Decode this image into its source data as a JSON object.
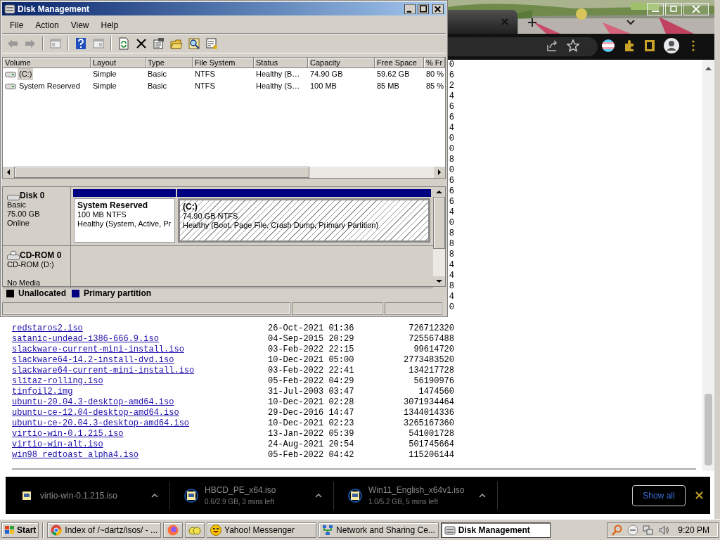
{
  "browser": {
    "listing": {
      "fragments": [
        "0",
        "6",
        "2",
        "4",
        "6",
        "6",
        "4",
        "0",
        "0",
        "8",
        "0",
        "6",
        "6",
        "6",
        "4",
        "0",
        "8",
        "8",
        "8",
        "4",
        "4",
        "8",
        "4",
        "0"
      ],
      "rows": [
        {
          "name": "redstaros2.iso",
          "date": "26-Oct-2021 01:36",
          "size": "726712320"
        },
        {
          "name": "satanic-undead-i386-666.9.iso",
          "date": "04-Sep-2015 20:29",
          "size": "725567488"
        },
        {
          "name": "slackware-current-mini-install.iso",
          "date": "03-Feb-2022 22:15",
          "size": "99614720"
        },
        {
          "name": "slackware64-14.2-install-dvd.iso",
          "date": "10-Dec-2021 05:00",
          "size": "2773483520"
        },
        {
          "name": "slackware64-current-mini-install.iso",
          "date": "03-Feb-2022 22:41",
          "size": "134217728"
        },
        {
          "name": "slitaz-rolling.iso",
          "date": "05-Feb-2022 04:29",
          "size": "56190976"
        },
        {
          "name": "tinfoil2.img",
          "date": "31-Jul-2003 03:47",
          "size": "1474560"
        },
        {
          "name": "ubuntu-20.04.3-desktop-amd64.iso",
          "date": "10-Dec-2021 02:28",
          "size": "3071934464"
        },
        {
          "name": "ubuntu-ce-12.04-desktop-amd64.iso",
          "date": "29-Dec-2016 14:47",
          "size": "1344014336"
        },
        {
          "name": "ubuntu-ce-20.04.3-desktop-amd64.iso",
          "date": "10-Dec-2021 02:23",
          "size": "3265167360"
        },
        {
          "name": "virtio-win-0.1.215.iso",
          "date": "13-Jan-2022 05:39",
          "size": "541001728"
        },
        {
          "name": "virtio-win-alt.iso",
          "date": "24-Aug-2021 20:54",
          "size": "501745664"
        },
        {
          "name": "win98_redtoast_alpha4.iso",
          "date": "05-Feb-2022 04:42",
          "size": "115206144"
        }
      ]
    },
    "downloads": [
      {
        "name": "virtio-win-0.1.215.iso"
      },
      {
        "name": "HBCD_PE_x64.iso",
        "detail": "0.6/2.9 GB, 3 mins left"
      },
      {
        "name": "Win11_English_x64v1.iso",
        "detail": "1.0/5.2 GB, 5 mins left"
      }
    ],
    "show_all": "Show all"
  },
  "disk_management": {
    "title": "Disk Management",
    "menu": [
      "File",
      "Action",
      "View",
      "Help"
    ],
    "columns": [
      "Volume",
      "Layout",
      "Type",
      "File System",
      "Status",
      "Capacity",
      "Free Space",
      "% Fr"
    ],
    "volumes": [
      {
        "cells": [
          "(C:)",
          "Simple",
          "Basic",
          "NTFS",
          "Healthy (B…",
          "74.90 GB",
          "59.62 GB",
          "80 %"
        ],
        "selected": true
      },
      {
        "cells": [
          "System Reserved",
          "Simple",
          "Basic",
          "NTFS",
          "Healthy (S…",
          "100 MB",
          "85 MB",
          "85 %"
        ],
        "selected": false
      }
    ],
    "disks": [
      {
        "kind": "disk",
        "name": "Disk 0",
        "lines": [
          "Basic",
          "75.00 GB",
          "Online"
        ],
        "partitions": [
          {
            "name": "System Reserved",
            "size": "100 MB NTFS",
            "status": "Healthy (System, Active, Pr",
            "selected": false
          },
          {
            "name": "(C:)",
            "size": "74.90 GB NTFS",
            "status": "Healthy (Boot, Page File, Crash Dump, Primary Partition)",
            "selected": true
          }
        ]
      },
      {
        "kind": "cdrom",
        "name": "CD-ROM 0",
        "lines": [
          "CD-ROM (D:)",
          "No Media"
        ]
      }
    ],
    "legend": [
      {
        "label": "Unallocated",
        "color": "#000000"
      },
      {
        "label": "Primary partition",
        "color": "#000080"
      }
    ]
  },
  "taskbar": {
    "start": "Start",
    "items": [
      {
        "kind": "chrome",
        "label": "Index of /~dartz/isos/ - ...",
        "selected": false
      },
      {
        "kind": "firefox",
        "selected": false
      },
      {
        "kind": "folder",
        "selected": false
      },
      {
        "kind": "yahoo",
        "label": "Yahoo! Messenger",
        "selected": false
      },
      {
        "kind": "network",
        "label": "Network and Sharing Ce...",
        "selected": false
      },
      {
        "kind": "disk",
        "label": "Disk Management",
        "selected": true
      }
    ],
    "clock": "9:20 PM"
  }
}
